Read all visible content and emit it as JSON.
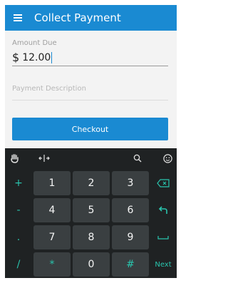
{
  "app_bar": {
    "title": "Collect Payment"
  },
  "form": {
    "amount_label": "Amount Due",
    "currency_symbol": "$",
    "amount_value": "12.00",
    "description_placeholder": "Payment Description",
    "checkout_label": "Checkout"
  },
  "keyboard": {
    "toolbar": [
      "emoji-hand-icon",
      "cursor-move-icon",
      "search-icon",
      "smiley-icon"
    ],
    "rows": [
      {
        "left": "+",
        "keys": [
          "1",
          "2",
          "3"
        ],
        "right_icon": "backspace-icon"
      },
      {
        "left": "-",
        "keys": [
          "4",
          "5",
          "6"
        ],
        "right_icon": "undo-arrow-icon"
      },
      {
        "left": ".",
        "keys": [
          "7",
          "8",
          "9"
        ],
        "right_icon": "space-bar-icon"
      },
      {
        "left": "/",
        "keys": [
          "*",
          "0",
          "#"
        ],
        "right_label": "Next"
      }
    ],
    "accent_color": "#29c4ad"
  },
  "colors": {
    "primary": "#1a8ad2",
    "keyboard_bg": "#1f2223",
    "key_bg": "#3a3f41"
  }
}
